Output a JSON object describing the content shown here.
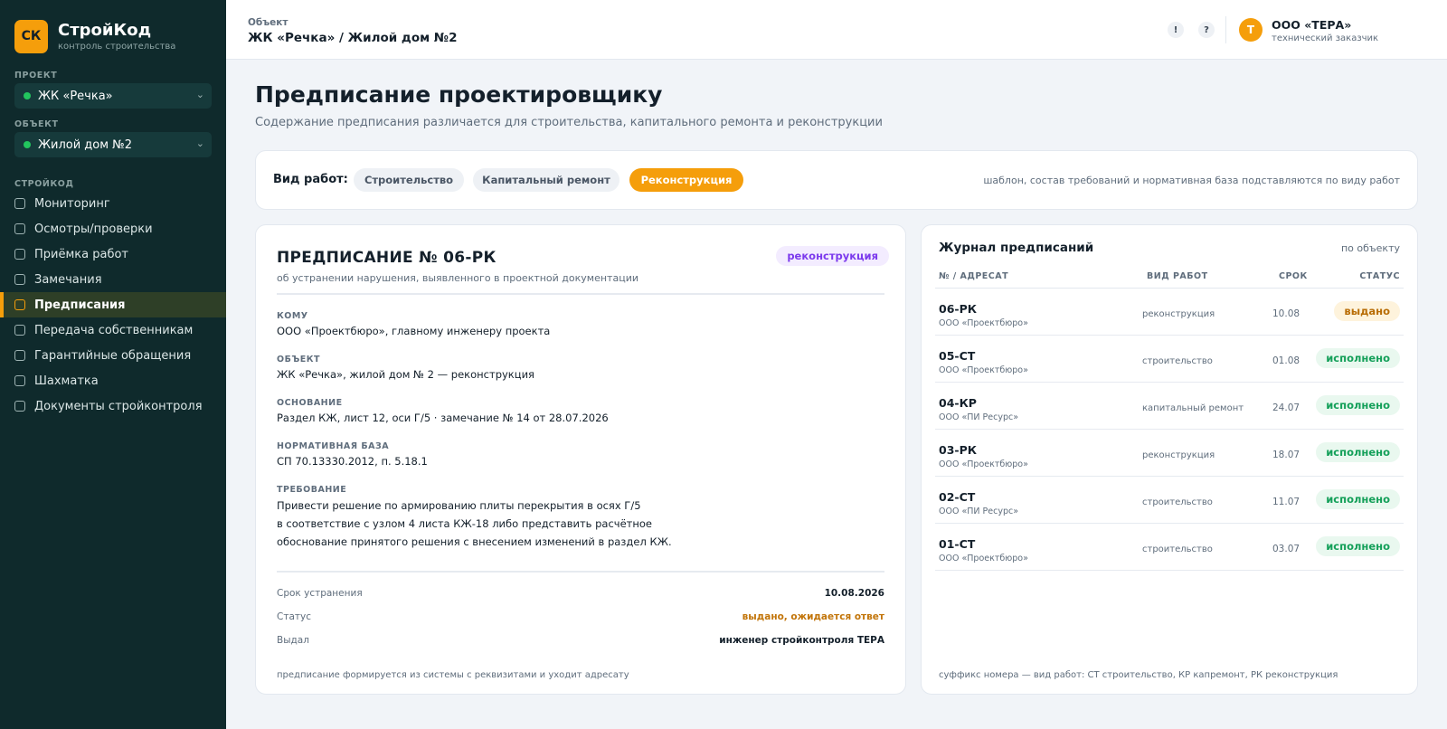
{
  "brand": {
    "logo": "СК",
    "name": "СтройКод",
    "subtitle": "контроль строительства"
  },
  "sidebar": {
    "project_label": "ПРОЕКТ",
    "project_value": "ЖК «Речка»",
    "object_label": "ОБЪЕКТ",
    "object_value": "Жилой дом №2",
    "section_label": "СТРОЙКОД",
    "items": [
      {
        "label": "Мониторинг"
      },
      {
        "label": "Осмотры/проверки"
      },
      {
        "label": "Приёмка работ"
      },
      {
        "label": "Замечания"
      },
      {
        "label": "Предписания",
        "active": true
      },
      {
        "label": "Передача собственникам"
      },
      {
        "label": "Гарантийные обращения"
      },
      {
        "label": "Шахматка"
      },
      {
        "label": "Документы стройконтроля"
      }
    ],
    "icons": {
      "select_chevron": "chevron-down-icon",
      "status_dot": "status-dot-icon",
      "nav_checkbox": "checkbox-icon"
    },
    "accent_color": "#f59e0b"
  },
  "header": {
    "object_label": "Объект",
    "title": "ЖК «Речка» / Жилой дом №2",
    "alert_icon": "!",
    "help_icon": "?",
    "user": {
      "initial": "Т",
      "name": "ООО «ТЕРА»",
      "role": "технический заказчик"
    }
  },
  "page": {
    "title": "Предписание проектировщику",
    "subtitle": "Содержание предписания различается для строительства, капитального ремонта и реконструкции"
  },
  "worktype": {
    "label": "Вид работ:",
    "options": [
      {
        "label": "Строительство"
      },
      {
        "label": "Капитальный ремонт"
      },
      {
        "label": "Реконструкция",
        "active": true
      }
    ],
    "hint": "шаблон, состав требований и нормативная база подставляются по виду работ"
  },
  "document": {
    "title": "ПРЕДПИСАНИЕ № 06-РК",
    "subtitle": "об устранении нарушения, выявленного в проектной документации",
    "type_badge": "реконструкция",
    "fields": [
      {
        "label": "КОМУ",
        "value": "ООО «Проектбюро», главному инженеру проекта"
      },
      {
        "label": "ОБЪЕКТ",
        "value": "ЖК «Речка», жилой дом № 2 — реконструкция"
      },
      {
        "label": "ОСНОВАНИЕ",
        "value": "Раздел КЖ, лист 12, оси Г/5 · замечание № 14 от 28.07.2026"
      },
      {
        "label": "НОРМАТИВНАЯ БАЗА",
        "value": "СП 70.13330.2012, п. 5.18.1"
      }
    ],
    "requirement_label": "ТРЕБОВАНИЕ",
    "requirement_lines": [
      "Привести решение по армированию плиты перекрытия в осях Г/5",
      "в соответствие с узлом 4 листа КЖ-18 либо представить расчётное",
      "обоснование принятого решения с внесением изменений в раздел КЖ."
    ],
    "meta": [
      {
        "label": "Срок устранения",
        "value": "10.08.2026"
      },
      {
        "label": "Статус",
        "value": "выдано, ожидается ответ",
        "color": "#c2750a"
      },
      {
        "label": "Выдал",
        "value": "инженер стройконтроля ТЕРА"
      }
    ],
    "footnote": "предписание формируется из системы с реквизитами и уходит адресату"
  },
  "journal": {
    "title": "Журнал предписаний",
    "scope": "по объекту",
    "columns": {
      "number": "№ / АДРЕСАТ",
      "type": "ВИД РАБОТ",
      "date": "СРОК",
      "status": "СТАТУС"
    },
    "rows": [
      {
        "number": "06-РК",
        "addressee": "ООО «Проектбюро»",
        "type": "реконструкция",
        "date": "10.08",
        "status": "выдано",
        "state": "issued"
      },
      {
        "number": "05-СТ",
        "addressee": "ООО «Проектбюро»",
        "type": "строительство",
        "date": "01.08",
        "status": "исполнено",
        "state": "done"
      },
      {
        "number": "04-КР",
        "addressee": "ООО «ПИ Ресурс»",
        "type": "капитальный ремонт",
        "date": "24.07",
        "status": "исполнено",
        "state": "done"
      },
      {
        "number": "03-РК",
        "addressee": "ООО «Проектбюро»",
        "type": "реконструкция",
        "date": "18.07",
        "status": "исполнено",
        "state": "done"
      },
      {
        "number": "02-СТ",
        "addressee": "ООО «ПИ Ресурс»",
        "type": "строительство",
        "date": "11.07",
        "status": "исполнено",
        "state": "done"
      },
      {
        "number": "01-СТ",
        "addressee": "ООО «Проектбюро»",
        "type": "строительство",
        "date": "03.07",
        "status": "исполнено",
        "state": "done"
      }
    ],
    "footnote": "суффикс номера — вид работ: СТ строительство, КР капремонт, РК реконструкция",
    "status_colors": {
      "issued": "#b86d06",
      "done": "#15a05a"
    }
  }
}
